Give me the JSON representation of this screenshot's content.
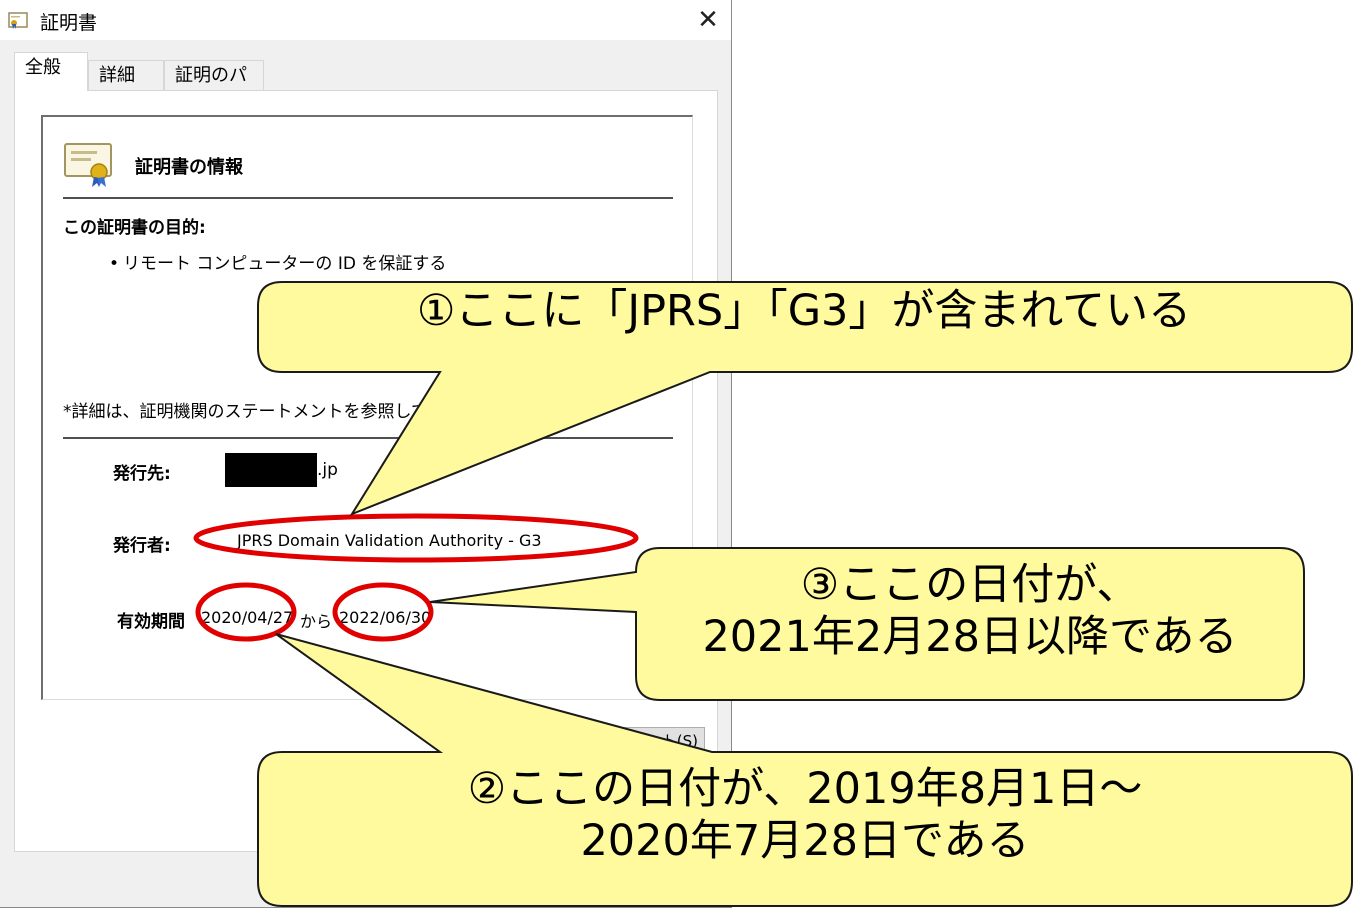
{
  "window": {
    "title": "証明書",
    "close_glyph": "✕"
  },
  "tabs": [
    {
      "label": "全般",
      "active": true
    },
    {
      "label": "詳細",
      "active": false
    },
    {
      "label": "証明のパス",
      "active": false
    }
  ],
  "info": {
    "title": "証明書の情報",
    "purpose_heading": "この証明書の目的:",
    "purpose_item": "リモート コンピューターの ID を保証する",
    "note": "*詳細は、証明機関のステートメントを参照してくだ",
    "issued_to_label": "発行先:",
    "issued_to_suffix": ".jp",
    "issued_by_label": "発行者:",
    "issued_by_value": "JPRS Domain Validation Authority - G3",
    "validity_label": "有効期間",
    "valid_from": "2020/04/27",
    "valid_separator": "から",
    "valid_to": "2022/06/30"
  },
  "hidden_button_label": "ト(S)",
  "callouts": [
    {
      "id": "callout-1",
      "lines": [
        "①ここに「JPRS」「G3」が含まれている"
      ]
    },
    {
      "id": "callout-3",
      "lines": [
        "③ここの日付が、",
        "2021年2月28日以降である"
      ]
    },
    {
      "id": "callout-2",
      "lines": [
        "②ここの日付が、2019年8月1日～",
        "2020年7月28日である"
      ]
    }
  ],
  "colors": {
    "callout_fill": "#fffa9e",
    "callout_stroke": "#1a1a1a",
    "highlight_ellipse": "#e00000",
    "redaction": "#000000"
  }
}
